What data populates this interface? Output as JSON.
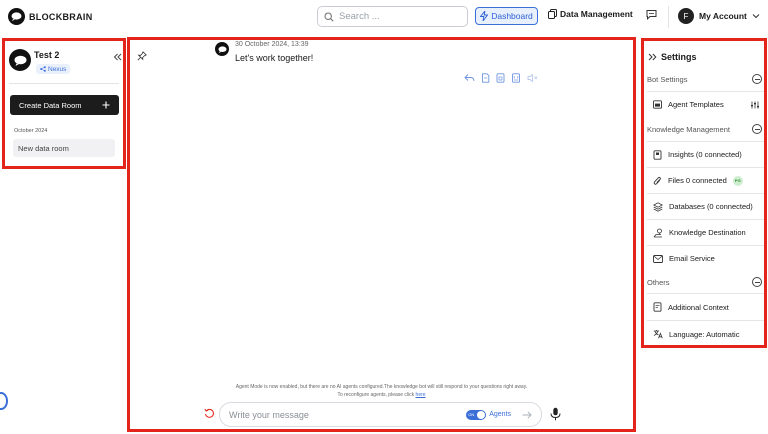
{
  "topbar": {
    "brand": "BLOCKBRAIN",
    "search_placeholder": "Search ...",
    "dashboard_label": "Dashboard",
    "data_management_label": "Data Management",
    "account_initial": "F",
    "account_label": "My Account"
  },
  "left_panel": {
    "room_title": "Test 2",
    "tag_label": "Nexus",
    "create_label": "Create Data Room",
    "date_group": "October 2024",
    "rooms": [
      {
        "label": "New data room"
      }
    ]
  },
  "chat": {
    "message": {
      "timestamp": "30 October 2024, 13:39",
      "text": "Let's work together!"
    },
    "notice_line1": "Agent Mode is now enabled, but there are no AI agents configured.The knowledge bot will still respond to your questions right away.",
    "notice_line2": "To reconfigure agents, please click ",
    "notice_link": "here",
    "input_placeholder": "Write your message",
    "toggle_state": "ON",
    "agents_label": "Agents"
  },
  "settings": {
    "title": "Settings",
    "sections": [
      {
        "label": "Bot Settings",
        "items": [
          {
            "label": "Agent Templates",
            "icon": "template-icon"
          }
        ]
      },
      {
        "label": "Knowledge Management",
        "items": [
          {
            "label": "Insights (0 connected)",
            "icon": "insights-icon"
          },
          {
            "label": "Files 0 connected",
            "icon": "paperclip-icon",
            "badge": "PG"
          },
          {
            "label": "Databases (0 connected)",
            "icon": "layers-icon"
          },
          {
            "label": "Knowledge Destination",
            "icon": "destination-icon"
          },
          {
            "label": "Email Service",
            "icon": "mail-icon"
          }
        ]
      },
      {
        "label": "Others",
        "items": [
          {
            "label": "Additional Context",
            "icon": "context-icon"
          },
          {
            "label": "Language: Automatic",
            "icon": "language-icon"
          }
        ]
      }
    ]
  },
  "colors": {
    "accent": "#3b6fd8",
    "highlight_border": "#e3241b",
    "dark": "#1c1c1c"
  }
}
